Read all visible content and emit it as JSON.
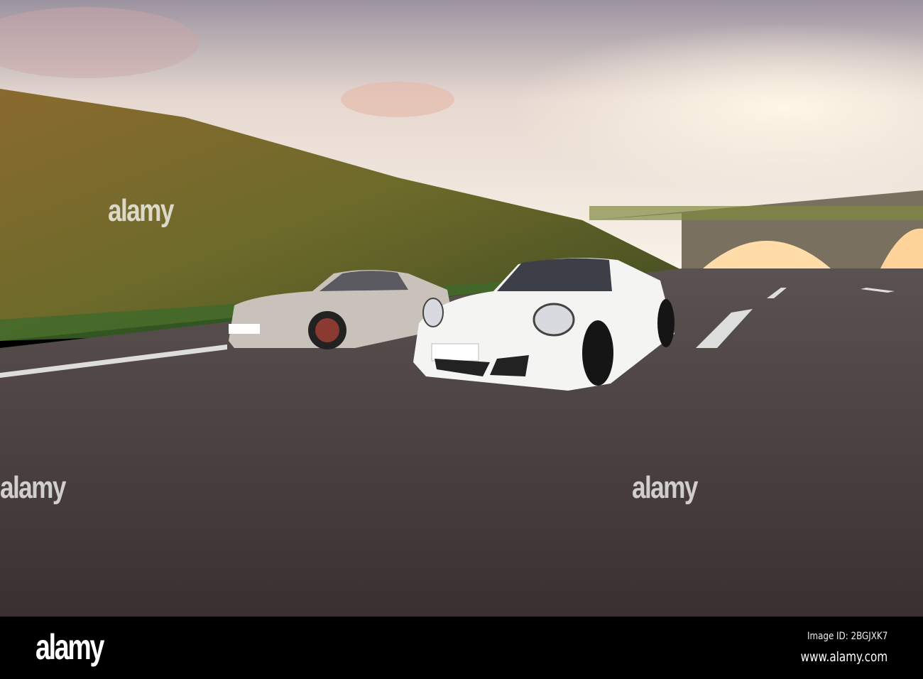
{
  "watermark": {
    "text": "alamy"
  },
  "footer": {
    "logo": "alamy",
    "image_id": "Image ID: 2BGJXK7",
    "website": "www.alamy.com"
  },
  "colors": {
    "sky": "#f3ece3",
    "hill": "#6a6428",
    "road": "#4a4140",
    "car_white": "#f4f4f2",
    "car_silver": "#c9c3bc"
  }
}
